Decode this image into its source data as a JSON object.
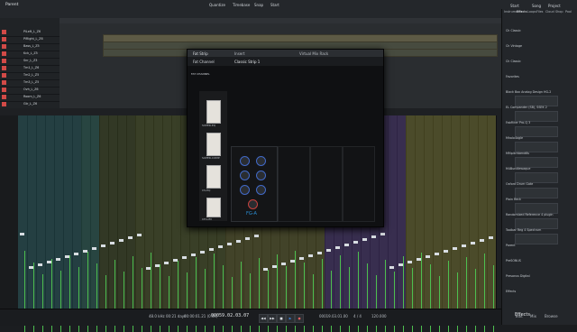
{
  "app": {
    "song_title": "Parent",
    "top_center_labels": [
      "Quantize",
      "Timebase",
      "Snap",
      "Start"
    ],
    "top_right_labels": [
      "Start",
      "Song",
      "Project"
    ]
  },
  "tracks": [
    {
      "name": "PiLeft_L_Z6",
      "color": "#d24a47"
    },
    {
      "name": "PiRight_L_Z6",
      "color": "#d24a47"
    },
    {
      "name": "Bass_L_Z5",
      "color": "#d24a47"
    },
    {
      "name": "Kck_L_Z5",
      "color": "#d24a47"
    },
    {
      "name": "Snr_L_Z3",
      "color": "#d24a47"
    },
    {
      "name": "Tm1_L_Z6",
      "color": "#d24a47"
    },
    {
      "name": "Tm2_L_Z5",
      "color": "#d24a47"
    },
    {
      "name": "Tm3_L_Z5",
      "color": "#d24a47"
    },
    {
      "name": "Ovh_L_Z6",
      "color": "#d24a47"
    },
    {
      "name": "Room_L_Z6",
      "color": "#d24a47"
    },
    {
      "name": "Gtr_L_Z6",
      "color": "#d24a47"
    }
  ],
  "plugin": {
    "window_tabs": [
      "Fat Strip",
      "Insert",
      "Virtual Mix Rack"
    ],
    "preset_name": "Classic Strip 1",
    "rack_title": "Fat Channel",
    "module_name": "FG-A",
    "side_units": [
      "SUPER-EQ",
      "SUPER-COMP",
      "CS-EQ",
      "CH-LIM"
    ],
    "logo_text": "FAT CHANNEL"
  },
  "browser": {
    "tabs": [
      "Instruments",
      "Effects",
      "Loops",
      "Files",
      "Cloud",
      "Shop",
      "Pool"
    ],
    "items": [
      "Ch Classic",
      "Ch Vintage",
      "Ch Classic",
      "Favorites",
      "Black Box Analog Design HG-2",
      "EL Compander (SB), SSEK 2",
      "FabFilter Pro-Q 3",
      "Mhalo4ogle",
      "MMpitchbend6s",
      "M4Bundlewaque",
      "Oxford Drum Gate",
      "Plain Reck",
      "Randomized Reference 4 plugin",
      "Toolbar Reg 4 Spectrum",
      "Parent",
      "PreSONUS",
      "Presonus Digital",
      "Effects"
    ],
    "footer_title": "Effects"
  },
  "mixer": {
    "channel_count": 53,
    "channel_colors": [
      "#2f7e82",
      "#2f7e82",
      "#2f7e82",
      "#2f7e82",
      "#2f7e82",
      "#2f7e82",
      "#2f7e82",
      "#3c8f7e",
      "#3c8f7e",
      "#5b6a2b",
      "#5b6a2b",
      "#5b6a2b",
      "#5b6a2b",
      "#6e7d31",
      "#6e7d31",
      "#6e7d31",
      "#6e7d31",
      "#6e7d31",
      "#6e7d31",
      "#6e7d31",
      "#6e7d31",
      "#6e7d31",
      "#6e7d31",
      "#8b8a35",
      "#8b8a35",
      "#8b8a35",
      "#8b8a35",
      "#8b8a35",
      "#8b8a35",
      "#8b8a35",
      "#8b8a35",
      "#8b8a35",
      "#8b8a35",
      "#8b8a35",
      "#6c4aa8",
      "#6c4aa8",
      "#6c4aa8",
      "#6c4aa8",
      "#6c4aa8",
      "#6c4aa8",
      "#6c4aa8",
      "#6c4aa8",
      "#6c4aa8",
      "#a6a23a",
      "#a6a23a",
      "#a6a23a",
      "#a6a23a",
      "#a6a23a",
      "#a6a23a",
      "#a6a23a",
      "#a6a23a",
      "#a6a23a",
      "#a6a23a",
      "#3d3d3d"
    ]
  },
  "transport": {
    "left_readouts": [
      "48.0 kHz",
      "00:21 days",
      "00:00:01.21 (0.0s)"
    ],
    "time_display": "00059.02.03.07",
    "tempo": "00019.03.01.00",
    "signature": "4 / 4",
    "bpm": "120.000",
    "right_labels": [
      "Edit",
      "Mix",
      "Browse"
    ],
    "master_label": "Main"
  },
  "accent": "#3e83d9"
}
